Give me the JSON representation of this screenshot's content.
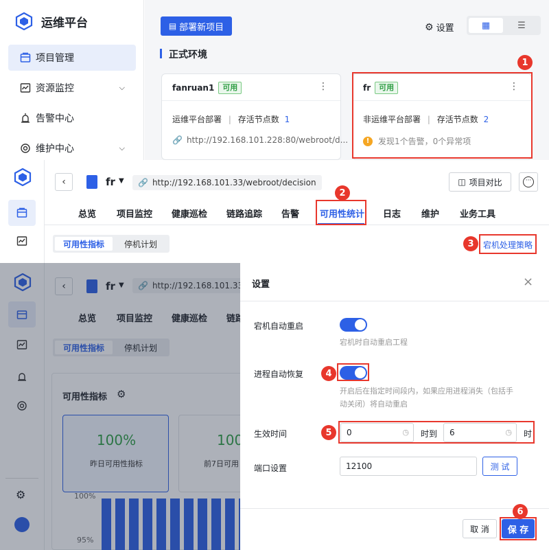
{
  "top": {
    "brand": "运维平台",
    "nav": [
      {
        "label": "项目管理",
        "icon": "project-icon",
        "active": true
      },
      {
        "label": "资源监控",
        "icon": "monitor-icon",
        "expand": true
      },
      {
        "label": "告警中心",
        "icon": "alarm-icon"
      },
      {
        "label": "维护中心",
        "icon": "maintain-icon",
        "expand": true
      }
    ],
    "deploy_button": "部署新项目",
    "settings_label": "设置",
    "section_title": "正式环境",
    "cards": [
      {
        "name": "fanruan1",
        "status": "可用",
        "line1": "运维平台部署",
        "sep": "|",
        "nodes_label": "存活节点数",
        "nodes": "1",
        "url": "http://192.168.101.228:80/webroot/d..."
      },
      {
        "name": "fr",
        "status": "可用",
        "line1": "非运维平台部署",
        "sep": "|",
        "nodes_label": "存活节点数",
        "nodes": "2",
        "warning": "发现1个告警，0个异常项"
      }
    ]
  },
  "middle": {
    "project_name": "fr",
    "url": "http://192.168.101.33/webroot/decision",
    "compare_button": "项目对比",
    "tabs": [
      "总览",
      "项目监控",
      "健康巡检",
      "链路追踪",
      "告警",
      "可用性统计",
      "日志",
      "维护",
      "业务工具"
    ],
    "subtabs": [
      "可用性指标",
      "停机计划"
    ],
    "strategy_link": "宕机处理策略"
  },
  "bottom": {
    "project_name": "fr",
    "url": "http://192.168.101.33/webroot/decision",
    "tabs": [
      "总览",
      "项目监控",
      "健康巡检",
      "链路"
    ],
    "subtabs": [
      "可用性指标",
      "停机计划"
    ],
    "section_title": "可用性指标",
    "stat1_value": "100%",
    "stat1_label": "昨日可用性指标",
    "stat2_value": "100",
    "stat2_label": "前7日可用",
    "axis_top": "100%",
    "axis_bottom": "95%"
  },
  "dialog": {
    "title": "设置",
    "auto_restart_label": "宕机自动重启",
    "auto_restart_desc": "宕机时自动重启工程",
    "auto_restart_on": true,
    "process_recover_label": "进程自动恢复",
    "process_recover_desc1": "开启后在指定时间段内，如果应用进程消失（包括手",
    "process_recover_desc2": "动关闭）将自动重启",
    "process_recover_on": true,
    "effective_label": "生效时间",
    "time_start": "0",
    "time_to": "时到",
    "time_end": "6",
    "time_unit": "时",
    "port_label": "端口设置",
    "port_value": "12100",
    "test_button": "测 试",
    "cancel_button": "取 消",
    "save_button": "保 存"
  },
  "badges": [
    "1",
    "2",
    "3",
    "4",
    "5",
    "6"
  ],
  "colors": {
    "accent": "#2d60e6",
    "highlight": "#e8372c",
    "success": "#2f9e44",
    "warning": "#f5a623"
  }
}
